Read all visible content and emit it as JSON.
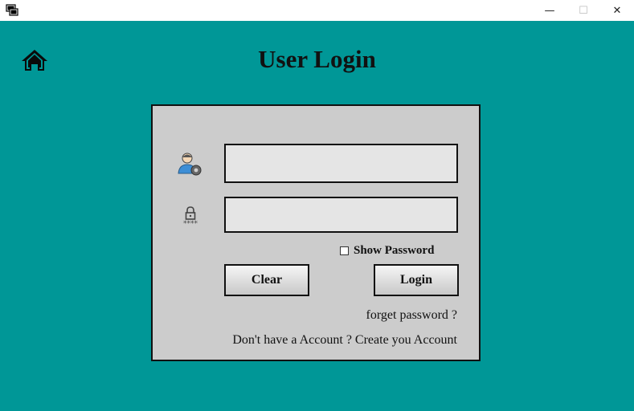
{
  "window": {
    "minimize_glyph": "—",
    "maximize_glyph": "☐",
    "close_glyph": "✕"
  },
  "page": {
    "title": "User Login"
  },
  "form": {
    "username_value": "",
    "password_value": "",
    "show_password_label": "Show Password",
    "show_password_checked": false,
    "clear_label": "Clear",
    "login_label": "Login",
    "forget_password_link": "forget password ?",
    "create_account_link": "Don't have a Account ? Create you Account"
  },
  "colors": {
    "background": "#009797",
    "panel": "#cccccc",
    "field": "#e5e5e5"
  },
  "icons": {
    "app": "app-icon",
    "home": "home-icon",
    "user": "user-settings-icon",
    "password": "lock-password-icon"
  }
}
